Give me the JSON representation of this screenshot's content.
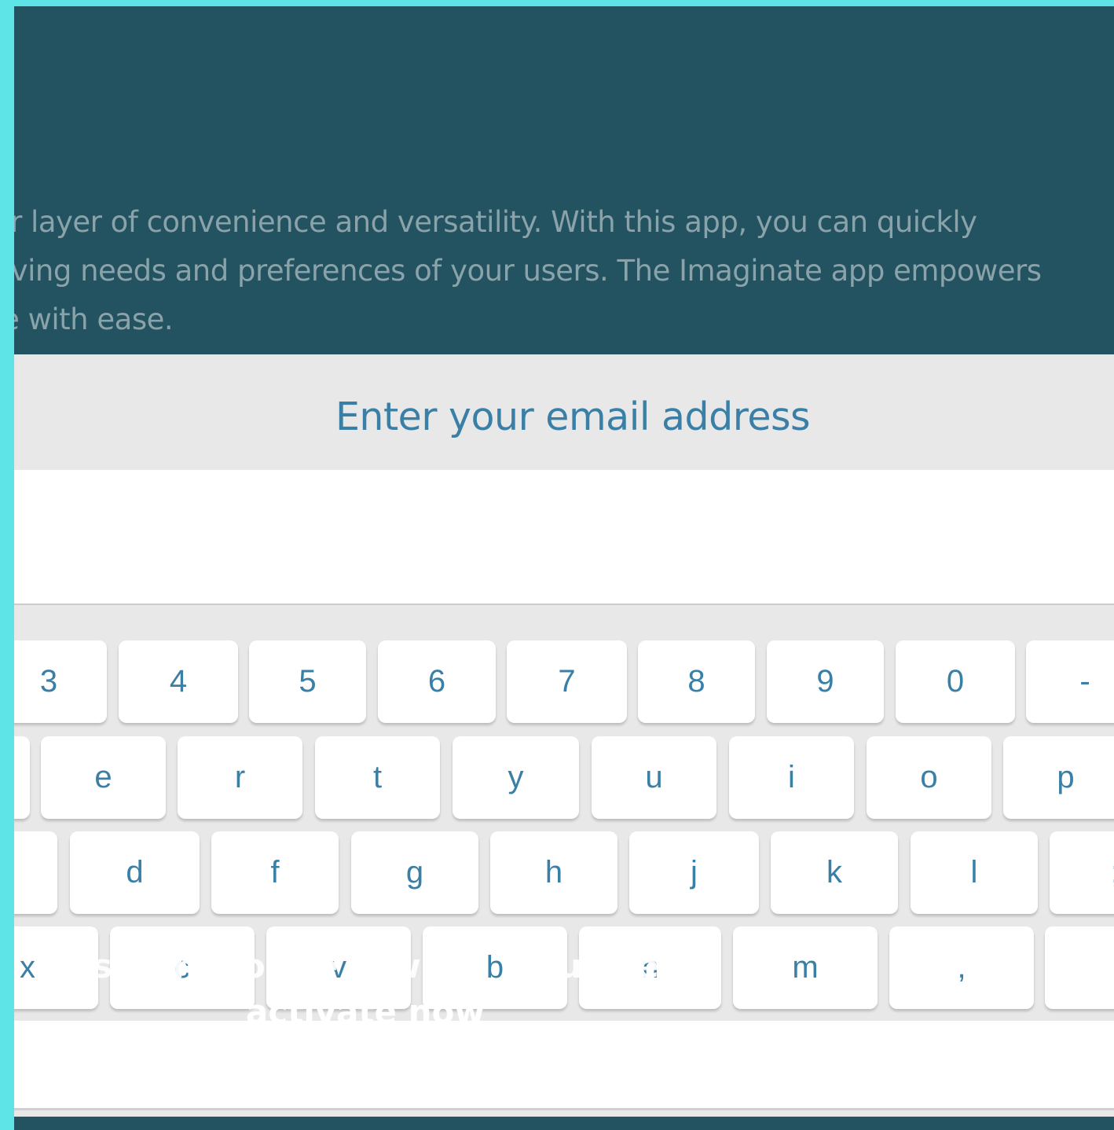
{
  "hero": {
    "lines": [
      "ovides another layer of convenience and versatility. With this app, you can quickly",
      "ptt to the evolving needs and preferences of your users. The Imaginate app empowers",
      "ble experience with ease."
    ]
  },
  "form": {
    "prompt": "Enter your email address",
    "email_value": ""
  },
  "keyboard": {
    "row1": [
      "3",
      "4",
      "5",
      "6",
      "7",
      "8",
      "9",
      "0",
      "-"
    ],
    "row2": [
      "e",
      "r",
      "t",
      "y",
      "u",
      "i",
      "o",
      "p"
    ],
    "row3": [
      "d",
      "f",
      "g",
      "h",
      "j",
      "k",
      "l",
      ";"
    ],
    "row4": [
      "x",
      "c",
      "v",
      "b",
      "n",
      "m",
      ",",
      "."
    ]
  },
  "cta": {
    "line1": "scan to see web source",
    "line2": "activate now"
  },
  "colors": {
    "page_border": "#5ee3e6",
    "hero_bg": "#235260",
    "accent_text": "#3a7fa6",
    "keyboard_bg": "#e8e8e8"
  }
}
